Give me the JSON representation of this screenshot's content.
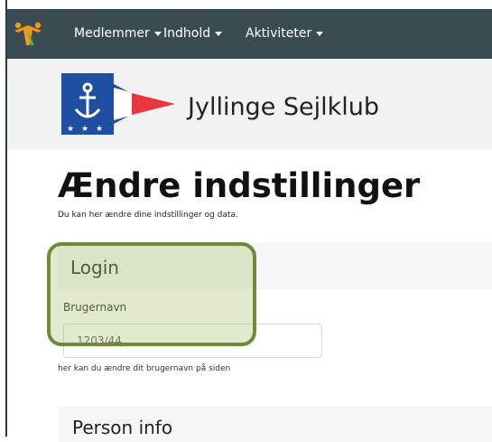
{
  "nav": {
    "items": [
      {
        "label": "Medlemmer"
      },
      {
        "label": "Indhold"
      },
      {
        "label": "Aktiviteter"
      }
    ]
  },
  "header": {
    "club_name": "Jyllinge Sejlklub"
  },
  "page": {
    "title": "Ændre indstillinger",
    "subtitle": "Du kan her ændre dine indstillinger og data."
  },
  "login": {
    "heading": "Login",
    "username_label": "Brugernavn",
    "username_value": "1203/44",
    "helper": "her kan du ændre dit brugernavn på siden"
  },
  "person_info": {
    "heading": "Person info"
  },
  "colors": {
    "navbar": "#3a4b52",
    "highlight_border": "#6f8b3a",
    "flag_blue": "#1f4fa0",
    "pennant_red": "#e8363c"
  },
  "icons": [
    "club-logo-icon",
    "club-flag-icon",
    "anchor-icon"
  ]
}
